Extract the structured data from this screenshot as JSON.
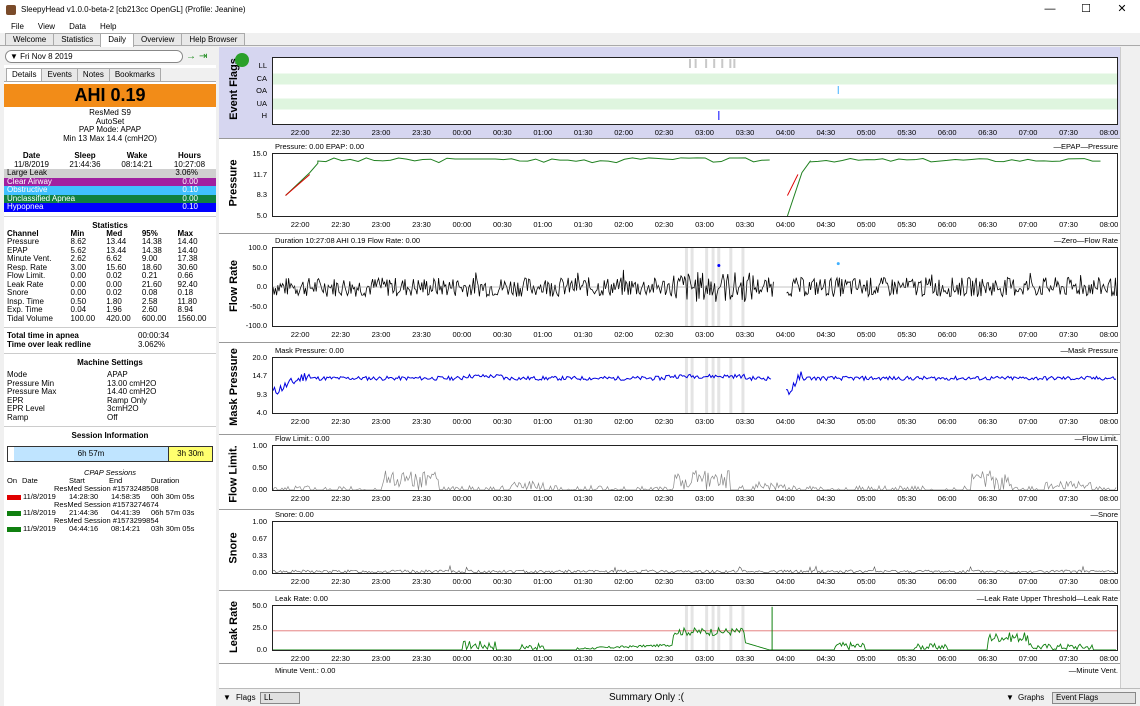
{
  "window": {
    "title": "SleepyHead v1.0.0-beta-2 [cb213cc OpenGL] (Profile: Jeanine)",
    "minimize": "—",
    "maximize": "☐",
    "close": "✕"
  },
  "menu": [
    "File",
    "View",
    "Data",
    "Help"
  ],
  "tabs": [
    "Welcome",
    "Statistics",
    "Daily",
    "Overview",
    "Help Browser"
  ],
  "date": "Fri Nov 8 2019",
  "subtabs": [
    "Details",
    "Events",
    "Notes",
    "Bookmarks"
  ],
  "ahi": "AHI 0.19",
  "machine": [
    "ResMed S9",
    "AutoSet",
    "PAP Mode: APAP",
    "Min 13 Max 14.4 (cmH2O)"
  ],
  "sleep": {
    "headers": [
      "Date",
      "Sleep",
      "Wake",
      "Hours"
    ],
    "values": [
      "11/8/2019",
      "21:44:36",
      "08:14:21",
      "10:27:08"
    ]
  },
  "events": [
    {
      "label": "Large Leak",
      "value": "3.06%",
      "color": "#d0d0d0"
    },
    {
      "label": "Clear Airway",
      "value": "0.00",
      "color": "#a020a0"
    },
    {
      "label": "Obstructive",
      "value": "0.10",
      "color": "#40c0ff"
    },
    {
      "label": "Unclassified Apnea",
      "value": "0.00",
      "color": "#108040"
    },
    {
      "label": "Hypopnea",
      "value": "0.10",
      "color": "#0000ff"
    }
  ],
  "statistics": {
    "title": "Statistics",
    "headers": [
      "Channel",
      "Min",
      "Med",
      "95%",
      "Max"
    ],
    "rows": [
      [
        "Pressure",
        "8.62",
        "13.44",
        "14.38",
        "14.40"
      ],
      [
        "EPAP",
        "5.62",
        "13.44",
        "14.38",
        "14.40"
      ],
      [
        "Minute Vent.",
        "2.62",
        "6.62",
        "9.00",
        "17.38"
      ],
      [
        "Resp. Rate",
        "3.00",
        "15.60",
        "18.60",
        "30.60"
      ],
      [
        "Flow Limit.",
        "0.00",
        "0.02",
        "0.21",
        "0.66"
      ],
      [
        "Leak Rate",
        "0.00",
        "0.00",
        "21.60",
        "92.40"
      ],
      [
        "Snore",
        "0.00",
        "0.02",
        "0.08",
        "0.18"
      ],
      [
        "Insp. Time",
        "0.50",
        "1.80",
        "2.58",
        "11.80"
      ],
      [
        "Exp. Time",
        "0.04",
        "1.96",
        "2.60",
        "8.94"
      ],
      [
        "Tidal Volume",
        "100.00",
        "420.00",
        "600.00",
        "1560.00"
      ]
    ]
  },
  "totals": [
    {
      "label": "Total time in apnea",
      "value": "00:00:34"
    },
    {
      "label": "Time over leak redline",
      "value": "3.062%"
    }
  ],
  "settings": {
    "title": "Machine Settings",
    "rows": [
      [
        "Mode",
        "APAP"
      ],
      [
        "Pressure Min",
        "13.00 cmH2O"
      ],
      [
        "Pressure Max",
        "14.40 cmH2O"
      ],
      [
        "EPR",
        "Ramp Only"
      ],
      [
        "EPR Level",
        "3cmH2O"
      ],
      [
        "Ramp",
        "Off"
      ]
    ]
  },
  "session_info": {
    "title": "Session Information",
    "bar1": "6h 57m",
    "bar2": "3h 30m"
  },
  "sessions": {
    "caption": "CPAP Sessions",
    "headers": [
      "On",
      "Date",
      "Start",
      "End",
      "Duration"
    ],
    "rows": [
      {
        "name": "ResMed Session #1573248508",
        "date": "11/8/2019",
        "start": "14:28:30",
        "end": "14:58:35",
        "dur": "00h 30m 05s",
        "color": "#e00000"
      },
      {
        "name": "ResMed Session #1573274674",
        "date": "11/8/2019",
        "start": "21:44:36",
        "end": "04:41:39",
        "dur": "06h 57m 03s",
        "color": "#108010"
      },
      {
        "name": "ResMed Session #1573299854",
        "date": "11/9/2019",
        "start": "04:44:16",
        "end": "08:14:21",
        "dur": "03h 30m 05s",
        "color": "#108010"
      }
    ]
  },
  "xticks": [
    "22:00",
    "22:30",
    "23:00",
    "23:30",
    "00:00",
    "00:30",
    "01:00",
    "01:30",
    "02:00",
    "02:30",
    "03:00",
    "03:30",
    "04:00",
    "04:30",
    "05:00",
    "05:30",
    "06:00",
    "06:30",
    "07:00",
    "07:30",
    "08:00"
  ],
  "panels": {
    "flags": {
      "label": "Event Flags",
      "rows": [
        "LL",
        "CA",
        "OA",
        "UA",
        "H"
      ]
    },
    "pressure": {
      "label": "Pressure",
      "title": "Pressure: 0.00 EPAP: 0.00",
      "legend": "—EPAP—Pressure",
      "yticks": [
        "15.0",
        "11.7",
        "8.3",
        "5.0"
      ]
    },
    "flow": {
      "label": "Flow Rate",
      "title": "Duration 10:27:08 AHI 0.19 Flow Rate: 0.00",
      "legend": "—Zero—Flow Rate",
      "yticks": [
        "100.0",
        "50.0",
        "0.0",
        "-50.0",
        "-100.0"
      ]
    },
    "mask": {
      "label": "Mask Pressure",
      "title": "Mask Pressure: 0.00",
      "legend": "—Mask Pressure",
      "yticks": [
        "20.0",
        "14.7",
        "9.3",
        "4.0"
      ]
    },
    "flowlimit": {
      "label": "Flow Limit.",
      "title": "Flow Limit.: 0.00",
      "legend": "—Flow Limit.",
      "yticks": [
        "1.00",
        "0.50",
        "0.00"
      ]
    },
    "snore": {
      "label": "Snore",
      "title": "Snore: 0.00",
      "legend": "—Snore",
      "yticks": [
        "1.00",
        "0.67",
        "0.33",
        "0.00"
      ]
    },
    "leak": {
      "label": "Leak Rate",
      "title": "Leak Rate: 0.00",
      "legend": "—Leak Rate Upper Threshold—Leak Rate",
      "yticks": [
        "50.0",
        "25.0",
        "0.0"
      ]
    },
    "minvent": {
      "title": "Minute Vent.: 0.00",
      "legend": "—Minute Vent."
    }
  },
  "bottom": {
    "flags": "Flags",
    "flags_value": "LL",
    "summary": "Summary Only :(",
    "graphs": "Graphs",
    "graphs_value": "Event Flags"
  }
}
